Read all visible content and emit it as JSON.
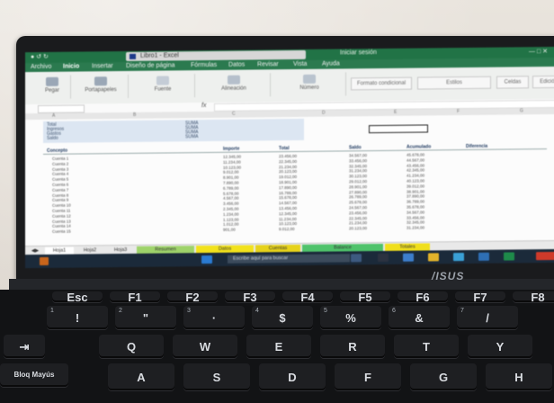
{
  "window": {
    "doc_title": "Libro1 - Excel",
    "title_suffix": "Iniciar sesión"
  },
  "ribbon": {
    "tabs": [
      "Archivo",
      "Inicio",
      "Insertar",
      "Diseño de página",
      "Fórmulas",
      "Datos",
      "Revisar",
      "Vista",
      "Ayuda"
    ],
    "active_tab": "Inicio",
    "buttons": [
      "Pegar",
      "Portapapeles",
      "Fuente",
      "Alineación",
      "Número",
      "Formato condicional",
      "Estilos",
      "Celdas",
      "Edición"
    ]
  },
  "summary": {
    "rows": [
      {
        "label": "Total",
        "value": "SUMA"
      },
      {
        "label": "Ingresos",
        "value": "SUMA"
      },
      {
        "label": "Gastos",
        "value": "SUMA"
      },
      {
        "label": "Saldo",
        "value": "SUMA"
      }
    ]
  },
  "table": {
    "headers": [
      "Concepto",
      "Importe",
      "Total",
      "Saldo",
      "Acumulado",
      "Diferencia"
    ],
    "rows": [
      {
        "name": "Cuenta 1",
        "vals": [
          "12.345,00",
          "23.456,00",
          "34.567,00",
          "45.678,00"
        ]
      },
      {
        "name": "Cuenta 2",
        "vals": [
          "11.234,00",
          "22.345,00",
          "33.456,00",
          "44.567,00"
        ]
      },
      {
        "name": "Cuenta 3",
        "vals": [
          "10.123,00",
          "21.234,00",
          "32.345,00",
          "43.456,00"
        ]
      },
      {
        "name": "Cuenta 4",
        "vals": [
          "9.012,00",
          "20.123,00",
          "31.234,00",
          "42.345,00"
        ]
      },
      {
        "name": "Cuenta 5",
        "vals": [
          "8.901,00",
          "19.012,00",
          "30.123,00",
          "41.234,00"
        ]
      },
      {
        "name": "Cuenta 6",
        "vals": [
          "7.890,00",
          "18.901,00",
          "29.012,00",
          "40.123,00"
        ]
      },
      {
        "name": "Cuenta 7",
        "vals": [
          "6.789,00",
          "17.890,00",
          "28.901,00",
          "39.012,00"
        ]
      },
      {
        "name": "Cuenta 8",
        "vals": [
          "5.678,00",
          "16.789,00",
          "27.890,00",
          "38.901,00"
        ]
      },
      {
        "name": "Cuenta 9",
        "vals": [
          "4.567,00",
          "15.678,00",
          "26.789,00",
          "37.890,00"
        ]
      },
      {
        "name": "Cuenta 10",
        "vals": [
          "3.456,00",
          "14.567,00",
          "25.678,00",
          "36.789,00"
        ]
      },
      {
        "name": "Cuenta 11",
        "vals": [
          "2.345,00",
          "13.456,00",
          "24.567,00",
          "35.678,00"
        ]
      },
      {
        "name": "Cuenta 12",
        "vals": [
          "1.234,00",
          "12.345,00",
          "23.456,00",
          "34.567,00"
        ]
      },
      {
        "name": "Cuenta 13",
        "vals": [
          "1.123,00",
          "11.234,00",
          "22.345,00",
          "33.456,00"
        ]
      },
      {
        "name": "Cuenta 14",
        "vals": [
          "1.012,00",
          "10.123,00",
          "21.234,00",
          "32.345,00"
        ]
      },
      {
        "name": "Cuenta 15",
        "vals": [
          "901,00",
          "9.012,00",
          "20.123,00",
          "31.234,00"
        ]
      }
    ]
  },
  "sheet_tabs": [
    {
      "label": "Hoja1",
      "color": "#ffffff"
    },
    {
      "label": "Hoja2",
      "color": "#e9e9e9"
    },
    {
      "label": "Hoja3",
      "color": "#e9e9e9"
    },
    {
      "label": "Resumen",
      "color": "#9ed36a"
    },
    {
      "label": "Datos",
      "color": "#f2e21c"
    },
    {
      "label": "Cuentas",
      "color": "#e6d21a"
    },
    {
      "label": "Balance",
      "color": "#4fc36b"
    },
    {
      "label": "Totales",
      "color": "#f0df1c"
    }
  ],
  "taskbar": {
    "search_placeholder": "Escribe aquí para buscar"
  },
  "laptop": {
    "brand": "/ISUS"
  },
  "keyboard": {
    "row1": [
      {
        "k": "Esc",
        "s": ""
      },
      {
        "k": "F1",
        "s": ""
      },
      {
        "k": "F2",
        "s": ""
      },
      {
        "k": "F3",
        "s": ""
      },
      {
        "k": "F4",
        "s": ""
      },
      {
        "k": "F5",
        "s": ""
      },
      {
        "k": "F6",
        "s": ""
      },
      {
        "k": "F7",
        "s": ""
      },
      {
        "k": "F8",
        "s": ""
      }
    ],
    "row2": [
      {
        "k": "!",
        "s": "1"
      },
      {
        "k": "\"",
        "s": "2"
      },
      {
        "k": "·",
        "s": "3"
      },
      {
        "k": "$",
        "s": "4"
      },
      {
        "k": "%",
        "s": "5"
      },
      {
        "k": "&",
        "s": "6"
      },
      {
        "k": "/",
        "s": "7"
      }
    ],
    "row3": [
      {
        "k": "Q",
        "s": ""
      },
      {
        "k": "W",
        "s": ""
      },
      {
        "k": "E",
        "s": ""
      },
      {
        "k": "R",
        "s": ""
      },
      {
        "k": "T",
        "s": ""
      },
      {
        "k": "Y",
        "s": ""
      }
    ],
    "row4": [
      {
        "k": "A",
        "s": ""
      },
      {
        "k": "S",
        "s": ""
      },
      {
        "k": "D",
        "s": ""
      },
      {
        "k": "F",
        "s": ""
      },
      {
        "k": "G",
        "s": ""
      },
      {
        "k": "H",
        "s": ""
      }
    ],
    "caps_label": "Bloq Mayús"
  },
  "colors": {
    "excel_green": "#217346",
    "taskbar": "#1b2a3a",
    "keys": "#1e1f22"
  }
}
